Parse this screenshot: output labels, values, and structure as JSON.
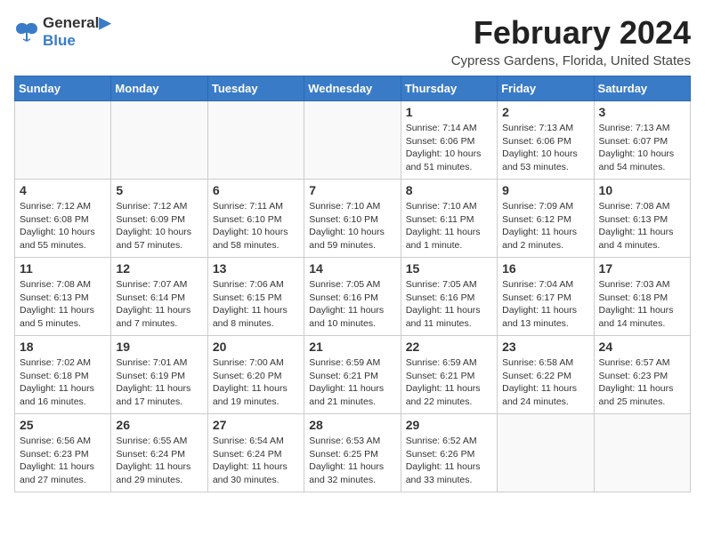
{
  "header": {
    "logo_line1": "General",
    "logo_line2": "Blue",
    "month_year": "February 2024",
    "location": "Cypress Gardens, Florida, United States"
  },
  "days_of_week": [
    "Sunday",
    "Monday",
    "Tuesday",
    "Wednesday",
    "Thursday",
    "Friday",
    "Saturday"
  ],
  "weeks": [
    [
      {
        "day": "",
        "info": ""
      },
      {
        "day": "",
        "info": ""
      },
      {
        "day": "",
        "info": ""
      },
      {
        "day": "",
        "info": ""
      },
      {
        "day": "1",
        "info": "Sunrise: 7:14 AM\nSunset: 6:06 PM\nDaylight: 10 hours\nand 51 minutes."
      },
      {
        "day": "2",
        "info": "Sunrise: 7:13 AM\nSunset: 6:06 PM\nDaylight: 10 hours\nand 53 minutes."
      },
      {
        "day": "3",
        "info": "Sunrise: 7:13 AM\nSunset: 6:07 PM\nDaylight: 10 hours\nand 54 minutes."
      }
    ],
    [
      {
        "day": "4",
        "info": "Sunrise: 7:12 AM\nSunset: 6:08 PM\nDaylight: 10 hours\nand 55 minutes."
      },
      {
        "day": "5",
        "info": "Sunrise: 7:12 AM\nSunset: 6:09 PM\nDaylight: 10 hours\nand 57 minutes."
      },
      {
        "day": "6",
        "info": "Sunrise: 7:11 AM\nSunset: 6:10 PM\nDaylight: 10 hours\nand 58 minutes."
      },
      {
        "day": "7",
        "info": "Sunrise: 7:10 AM\nSunset: 6:10 PM\nDaylight: 10 hours\nand 59 minutes."
      },
      {
        "day": "8",
        "info": "Sunrise: 7:10 AM\nSunset: 6:11 PM\nDaylight: 11 hours\nand 1 minute."
      },
      {
        "day": "9",
        "info": "Sunrise: 7:09 AM\nSunset: 6:12 PM\nDaylight: 11 hours\nand 2 minutes."
      },
      {
        "day": "10",
        "info": "Sunrise: 7:08 AM\nSunset: 6:13 PM\nDaylight: 11 hours\nand 4 minutes."
      }
    ],
    [
      {
        "day": "11",
        "info": "Sunrise: 7:08 AM\nSunset: 6:13 PM\nDaylight: 11 hours\nand 5 minutes."
      },
      {
        "day": "12",
        "info": "Sunrise: 7:07 AM\nSunset: 6:14 PM\nDaylight: 11 hours\nand 7 minutes."
      },
      {
        "day": "13",
        "info": "Sunrise: 7:06 AM\nSunset: 6:15 PM\nDaylight: 11 hours\nand 8 minutes."
      },
      {
        "day": "14",
        "info": "Sunrise: 7:05 AM\nSunset: 6:16 PM\nDaylight: 11 hours\nand 10 minutes."
      },
      {
        "day": "15",
        "info": "Sunrise: 7:05 AM\nSunset: 6:16 PM\nDaylight: 11 hours\nand 11 minutes."
      },
      {
        "day": "16",
        "info": "Sunrise: 7:04 AM\nSunset: 6:17 PM\nDaylight: 11 hours\nand 13 minutes."
      },
      {
        "day": "17",
        "info": "Sunrise: 7:03 AM\nSunset: 6:18 PM\nDaylight: 11 hours\nand 14 minutes."
      }
    ],
    [
      {
        "day": "18",
        "info": "Sunrise: 7:02 AM\nSunset: 6:18 PM\nDaylight: 11 hours\nand 16 minutes."
      },
      {
        "day": "19",
        "info": "Sunrise: 7:01 AM\nSunset: 6:19 PM\nDaylight: 11 hours\nand 17 minutes."
      },
      {
        "day": "20",
        "info": "Sunrise: 7:00 AM\nSunset: 6:20 PM\nDaylight: 11 hours\nand 19 minutes."
      },
      {
        "day": "21",
        "info": "Sunrise: 6:59 AM\nSunset: 6:21 PM\nDaylight: 11 hours\nand 21 minutes."
      },
      {
        "day": "22",
        "info": "Sunrise: 6:59 AM\nSunset: 6:21 PM\nDaylight: 11 hours\nand 22 minutes."
      },
      {
        "day": "23",
        "info": "Sunrise: 6:58 AM\nSunset: 6:22 PM\nDaylight: 11 hours\nand 24 minutes."
      },
      {
        "day": "24",
        "info": "Sunrise: 6:57 AM\nSunset: 6:23 PM\nDaylight: 11 hours\nand 25 minutes."
      }
    ],
    [
      {
        "day": "25",
        "info": "Sunrise: 6:56 AM\nSunset: 6:23 PM\nDaylight: 11 hours\nand 27 minutes."
      },
      {
        "day": "26",
        "info": "Sunrise: 6:55 AM\nSunset: 6:24 PM\nDaylight: 11 hours\nand 29 minutes."
      },
      {
        "day": "27",
        "info": "Sunrise: 6:54 AM\nSunset: 6:24 PM\nDaylight: 11 hours\nand 30 minutes."
      },
      {
        "day": "28",
        "info": "Sunrise: 6:53 AM\nSunset: 6:25 PM\nDaylight: 11 hours\nand 32 minutes."
      },
      {
        "day": "29",
        "info": "Sunrise: 6:52 AM\nSunset: 6:26 PM\nDaylight: 11 hours\nand 33 minutes."
      },
      {
        "day": "",
        "info": ""
      },
      {
        "day": "",
        "info": ""
      }
    ]
  ]
}
